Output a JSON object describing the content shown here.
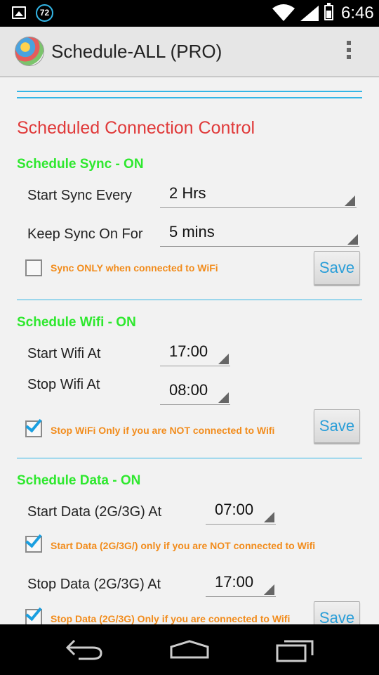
{
  "status_bar": {
    "badge": "72",
    "time": "6:46",
    "icons": [
      "gallery-icon",
      "wifi-icon",
      "signal-icon",
      "battery-icon"
    ]
  },
  "app_bar": {
    "title": "Schedule-ALL (PRO)"
  },
  "main": {
    "section_title": "Scheduled Connection Control",
    "sync": {
      "title": "Schedule Sync - ON",
      "start_label": "Start Sync Every",
      "start_value": "2 Hrs",
      "keep_label": "Keep Sync On For",
      "keep_value": "5 mins",
      "wifi_only_label": "Sync ONLY when connected to WiFi",
      "wifi_only_checked": false,
      "save_label": "Save"
    },
    "wifi": {
      "title": "Schedule Wifi - ON",
      "start_label": "Start Wifi At",
      "start_value": "17:00",
      "stop_label": "Stop Wifi At",
      "stop_value": "08:00",
      "option_label": "Stop WiFi Only if you are NOT connected to Wifi",
      "option_checked": true,
      "save_label": "Save"
    },
    "data": {
      "title": "Schedule Data - ON",
      "start_label": "Start Data (2G/3G) At",
      "start_value": "07:00",
      "start_option_label": "Start Data (2G/3G/) only if you are NOT connected to Wifi",
      "start_option_checked": true,
      "stop_label": "Stop Data (2G/3G) At",
      "stop_value": "17:00",
      "stop_option_label": "Stop Data (2G/3G) Only if you are connected to Wifi",
      "stop_option_checked": true,
      "save_label": "Save"
    }
  },
  "colors": {
    "accent": "#33b5e5",
    "section_title": "#e03a3a",
    "group_title": "#2ee82e",
    "option_text": "#f28c1c"
  }
}
